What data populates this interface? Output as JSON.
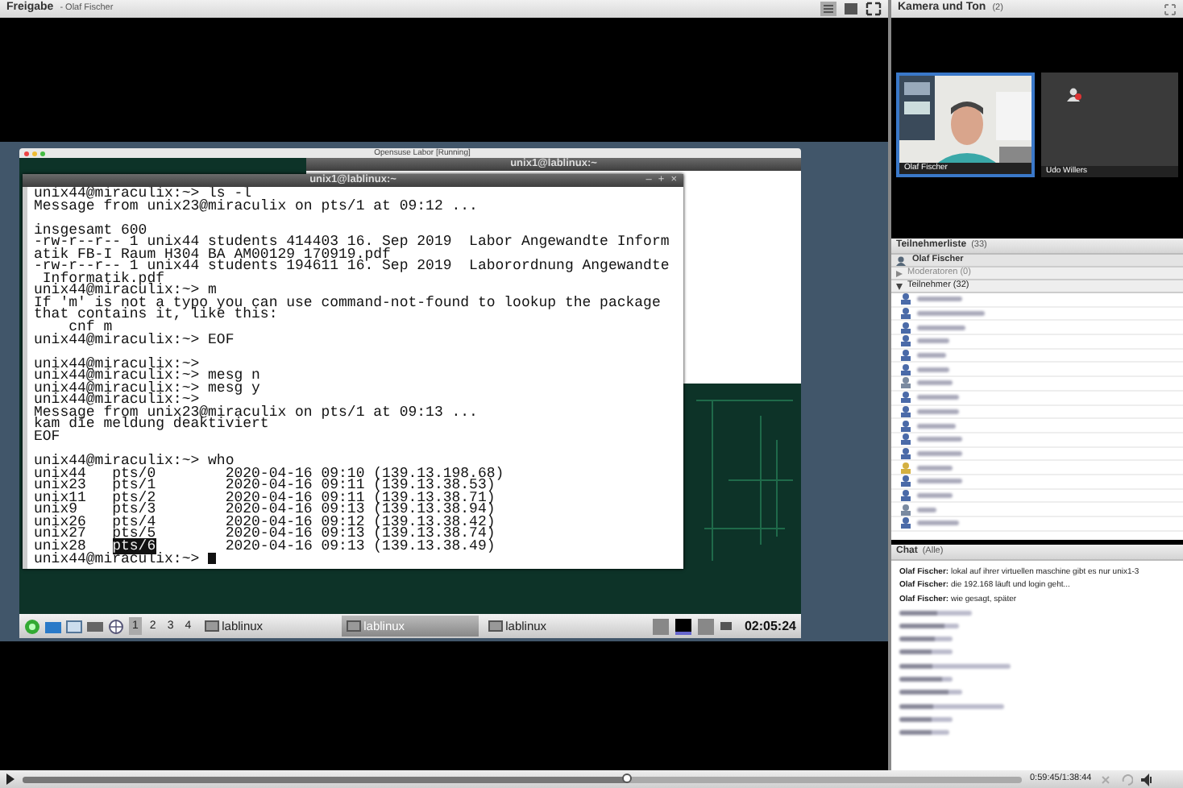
{
  "share": {
    "title": "Freigabe",
    "presenter": "- Olaf Fischer",
    "vm": {
      "title": "Opensuse Labor [Running]",
      "back_window": {
        "title": "unix1@lablinux:~"
      },
      "terminal": {
        "title": "unix1@lablinux:~",
        "controls": [
          "–",
          "+",
          "×"
        ],
        "lines": [
          "unix44@miraculix:~> ls -l",
          "Message from unix23@miraculix on pts/1 at 09:12 ...",
          {
            "kind": "blank"
          },
          "insgesamt 600",
          "-rw-r--r-- 1 unix44 students 414403 16. Sep 2019  Labor Angewandte Inform",
          "atik FB-I Raum H304 BA AM00129 170919.pdf",
          "-rw-r--r-- 1 unix44 students 194611 16. Sep 2019  Laborordnung Angewandte",
          " Informatik.pdf",
          "unix44@miraculix:~> m",
          "If 'm' is not a typo you can use command-not-found to lookup the package",
          "that contains it, like this:",
          "    cnf m",
          "unix44@miraculix:~> EOF",
          {
            "kind": "blank"
          },
          "unix44@miraculix:~>",
          "unix44@miraculix:~> mesg n",
          "unix44@miraculix:~> mesg y",
          "unix44@miraculix:~>",
          "Message from unix23@miraculix on pts/1 at 09:13 ...",
          "kam die meldung deaktiviert",
          "EOF",
          {
            "kind": "blank"
          },
          "unix44@miraculix:~> who",
          "unix44   pts/0        2020-04-16 09:10 (139.13.198.68)",
          "unix23   pts/1        2020-04-16 09:11 (139.13.38.53)",
          "unix11   pts/2        2020-04-16 09:11 (139.13.38.71)",
          "unix9    pts/3        2020-04-16 09:13 (139.13.38.94)",
          "unix26   pts/4        2020-04-16 09:12 (139.13.38.42)",
          "unix27   pts/5        2020-04-16 09:13 (139.13.38.74)",
          {
            "segments": [
              {
                "text": "unix28   ",
                "selected": false
              },
              {
                "text": "pts/6",
                "selected": true
              },
              {
                "text": "        2020-04-16 09:13 (139.13.38.49)",
                "selected": false
              }
            ]
          },
          "unix44@miraculix:~> "
        ]
      },
      "taskbar": {
        "workspaces": [
          {
            "label": "1",
            "selected": true
          },
          {
            "label": "2",
            "selected": false
          },
          {
            "label": "3",
            "selected": false
          },
          {
            "label": "4",
            "selected": false
          }
        ],
        "tasks": [
          {
            "label": "lablinux",
            "selected": false
          },
          {
            "label": "lablinux",
            "selected": true
          },
          {
            "label": "lablinux",
            "selected": false
          }
        ],
        "clock": "02:05:24"
      }
    }
  },
  "camera": {
    "title": "Kamera und Ton",
    "count": "(2)",
    "tiles": [
      {
        "name": "Olaf Fischer",
        "kind": "video"
      },
      {
        "name": "Udo Willers",
        "kind": "off"
      }
    ]
  },
  "attendees": {
    "title": "Teilnehmerliste",
    "count": "(33)",
    "presenter": "Olaf Fischer",
    "groups": [
      {
        "label": "Moderatoren (0)",
        "expanded": false
      },
      {
        "label": "Teilnehmer (32)",
        "expanded": true
      }
    ],
    "participants": [
      {
        "color": "#4a6aa8"
      },
      {
        "color": "#4a6aa8"
      },
      {
        "color": "#4a6aa8"
      },
      {
        "color": "#4a6aa8"
      },
      {
        "color": "#4a6aa8"
      },
      {
        "color": "#4a6aa8"
      },
      {
        "color": "#7a8aa0"
      },
      {
        "color": "#4a6aa8"
      },
      {
        "color": "#4a6aa8"
      },
      {
        "color": "#4a6aa8"
      },
      {
        "color": "#4a6aa8"
      },
      {
        "color": "#4a6aa8"
      },
      {
        "color": "#d4b040"
      },
      {
        "color": "#4a6aa8"
      },
      {
        "color": "#4a6aa8"
      },
      {
        "color": "#7a8aa0"
      },
      {
        "color": "#4a6aa8"
      }
    ]
  },
  "chat": {
    "title": "Chat",
    "scope": "(Alle)",
    "messages": [
      {
        "kind": "message",
        "author": "Olaf Fischer:",
        "text": "lokal auf ihrer virtuellen maschine gibt es nur unix1-3"
      },
      {
        "kind": "message",
        "author": "Olaf Fischer:",
        "text": "die 192.168 läuft und login geht..."
      },
      {
        "kind": "message",
        "author": "Olaf Fischer:",
        "text": "wie gesagt, später"
      },
      {
        "kind": "blurred"
      },
      {
        "kind": "blurred"
      },
      {
        "kind": "blurred"
      },
      {
        "kind": "blurred"
      },
      {
        "kind": "blurred"
      },
      {
        "kind": "blurred"
      },
      {
        "kind": "blurred"
      },
      {
        "kind": "blurred"
      },
      {
        "kind": "blurred"
      },
      {
        "kind": "blurred"
      }
    ]
  },
  "player": {
    "level": 0.605,
    "time": "0:59:45/1:38:44"
  }
}
